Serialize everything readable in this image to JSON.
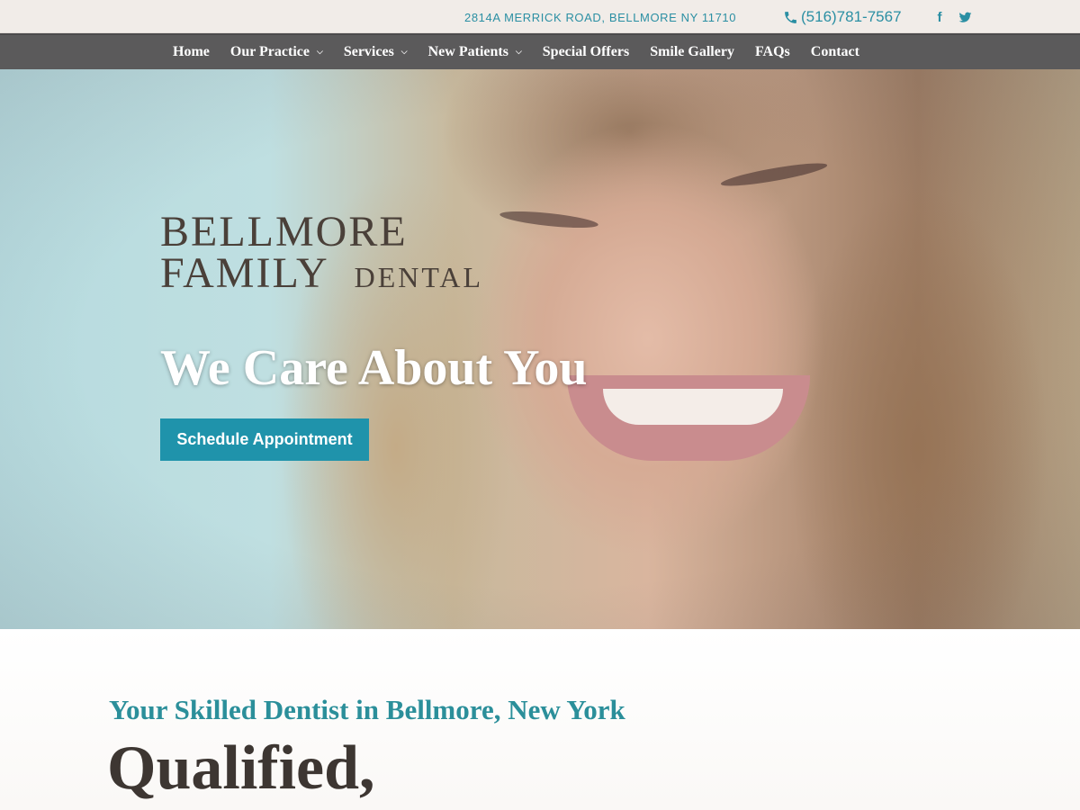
{
  "topbar": {
    "address": "2814A MERRICK ROAD, BELLMORE NY 11710",
    "phone": "(516)781-7567",
    "phone_icon": "phone-icon",
    "social": [
      {
        "name": "facebook-icon",
        "glyph": "f"
      },
      {
        "name": "twitter-icon",
        "glyph": "twitter"
      }
    ]
  },
  "nav": {
    "items": [
      {
        "label": "Home",
        "dropdown": false
      },
      {
        "label": "Our Practice",
        "dropdown": true
      },
      {
        "label": "Services",
        "dropdown": true
      },
      {
        "label": "New Patients",
        "dropdown": true
      },
      {
        "label": "Special Offers",
        "dropdown": false
      },
      {
        "label": "Smile Gallery",
        "dropdown": false
      },
      {
        "label": "FAQs",
        "dropdown": false
      },
      {
        "label": "Contact",
        "dropdown": false
      }
    ],
    "chevron": "⌄"
  },
  "hero": {
    "logo": {
      "line1": "BELLMORE",
      "line2": "FAMILY",
      "line3": "DENTAL"
    },
    "tagline": "We Care About You",
    "cta_label": "Schedule Appointment"
  },
  "content": {
    "subtitle": "Your Skilled Dentist in Bellmore, New York",
    "headline": "Qualified,"
  },
  "colors": {
    "accent": "#2b8fa3",
    "cta": "#1f93ab",
    "navbar": "#5b5a5b",
    "topbar": "#f1ece8",
    "headline": "#3d3632"
  }
}
